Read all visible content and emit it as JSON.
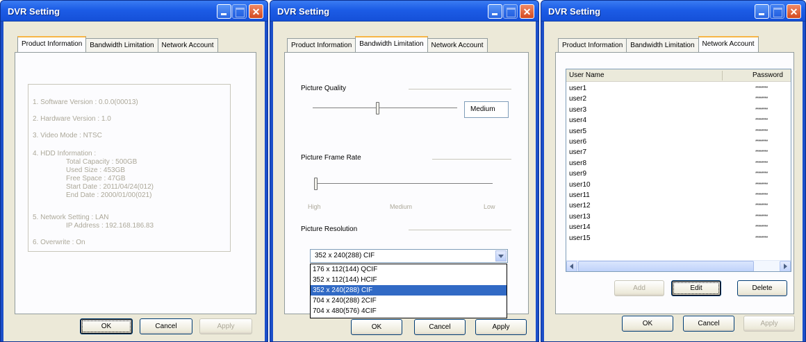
{
  "windows": [
    {
      "title": "DVR Setting",
      "tabs": [
        "Product Information",
        "Bandwidth Limitation",
        "Network Account"
      ],
      "active_tab": "Product Information",
      "info_lines": [
        "1. Software Version : 0.0.0(00013)",
        "2. Hardware Version : 1.0",
        "3. Video Mode : NTSC",
        "4. HDD Information :"
      ],
      "hdd_details": [
        "Total Capacity : 500GB",
        "Used Size : 453GB",
        "Free Space : 47GB",
        "Start Date : 2011/04/24(012)",
        "End Date : 2000/01/00(021)"
      ],
      "network_line": "5. Network Setting : LAN",
      "ip_line": "IP Address : 192.168.186.83",
      "overwrite_line": "6. Overwrite : On",
      "buttons": {
        "ok": "OK",
        "cancel": "Cancel",
        "apply": "Apply"
      }
    },
    {
      "title": "DVR Setting",
      "tabs": [
        "Product Information",
        "Bandwidth Limitation",
        "Network Account"
      ],
      "active_tab": "Bandwidth Limitation",
      "picture_quality_label": "Picture Quality",
      "quality_value": "Medium",
      "quality_level_fraction": 0.45,
      "frame_rate_label": "Picture Frame Rate",
      "frame_rate_level_fraction": 0.0,
      "rate_ticks": [
        "High",
        "Medium",
        "Low"
      ],
      "resolution_label": "Picture Resolution",
      "resolution_selected": "352 x 240(288) CIF",
      "resolution_options": [
        "176 x 112(144) QCIF",
        "352 x 112(144) HCIF",
        "352 x 240(288) CIF",
        "704 x 240(288) 2CIF",
        "704 x 480(576) 4CIF"
      ],
      "highlighted_option_index": 2,
      "buttons": {
        "ok": "OK",
        "cancel": "Cancel",
        "apply": "Apply"
      }
    },
    {
      "title": "DVR Setting",
      "tabs": [
        "Product Information",
        "Bandwidth Limitation",
        "Network Account"
      ],
      "active_tab": "Network Account",
      "columns": [
        "User Name",
        "Password"
      ],
      "users": [
        {
          "name": "user1",
          "password": "********"
        },
        {
          "name": "user2",
          "password": "********"
        },
        {
          "name": "user3",
          "password": "********"
        },
        {
          "name": "user4",
          "password": "********"
        },
        {
          "name": "user5",
          "password": "********"
        },
        {
          "name": "user6",
          "password": "********"
        },
        {
          "name": "user7",
          "password": "********"
        },
        {
          "name": "user8",
          "password": "********"
        },
        {
          "name": "user9",
          "password": "********"
        },
        {
          "name": "user10",
          "password": "********"
        },
        {
          "name": "user11",
          "password": "********"
        },
        {
          "name": "user12",
          "password": "********"
        },
        {
          "name": "user13",
          "password": "********"
        },
        {
          "name": "user14",
          "password": "********"
        },
        {
          "name": "user15",
          "password": "********"
        }
      ],
      "account_buttons": {
        "add": "Add",
        "edit": "Edit",
        "delete": "Delete"
      },
      "buttons": {
        "ok": "OK",
        "cancel": "Cancel",
        "apply": "Apply"
      }
    }
  ],
  "colors": {
    "titlebar": "#1c5ce6",
    "dialog_face": "#ece9d8",
    "selection": "#316ac5",
    "disabled_text": "#aca899",
    "tab_highlight": "#f7b545"
  }
}
